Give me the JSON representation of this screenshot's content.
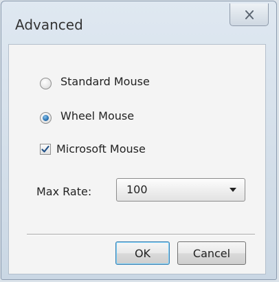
{
  "window": {
    "title": "Advanced",
    "close_icon": "close-x-icon"
  },
  "options": {
    "standard_mouse": {
      "label": "Standard Mouse",
      "selected": false
    },
    "wheel_mouse": {
      "label": "Wheel Mouse",
      "selected": true
    },
    "microsoft_mouse": {
      "label": "Microsoft Mouse",
      "checked": true
    }
  },
  "max_rate": {
    "label": "Max Rate:",
    "value": "100"
  },
  "buttons": {
    "ok": "OK",
    "cancel": "Cancel"
  },
  "colors": {
    "accent": "#2e77b6",
    "default_button_border": "#3c7fb1"
  }
}
